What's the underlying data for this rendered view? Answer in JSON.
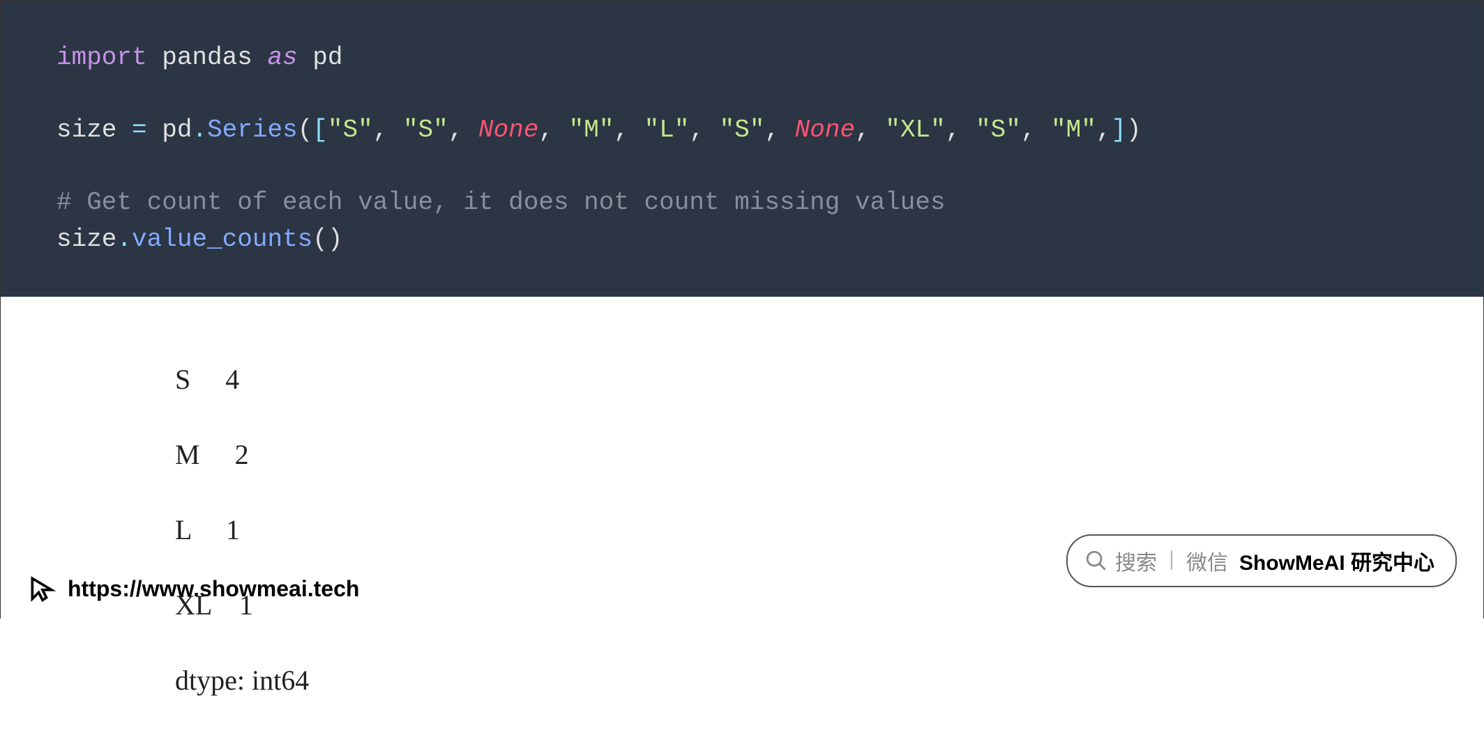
{
  "code": {
    "line1_import": "import",
    "line1_pandas": " pandas ",
    "line1_as": "as",
    "line1_pd": " pd",
    "line3_size": "size ",
    "line3_eq": "=",
    "line3_pd": " pd",
    "line3_dot": ".",
    "line3_series": "Series",
    "line3_po": "(",
    "line3_bo": "[",
    "line3_s1": "\"S\"",
    "line3_c": ", ",
    "line3_s2": "\"S\"",
    "line3_n1": "None",
    "line3_m1": "\"M\"",
    "line3_l1": "\"L\"",
    "line3_s3": "\"S\"",
    "line3_n2": "None",
    "line3_xl": "\"XL\"",
    "line3_s4": "\"S\"",
    "line3_m2": "\"M\"",
    "line3_trail": ",",
    "line3_bc": "]",
    "line3_pc": ")",
    "line5_comment": "# Get count of each value, it does not count missing values",
    "line6_size": "size",
    "line6_dot": ".",
    "line6_vc": "value_counts",
    "line6_po": "(",
    "line6_pc": ")"
  },
  "output": {
    "r1": "S     4",
    "r2": "M     2",
    "r3": "L     1",
    "r4": "XL    1",
    "r5": "dtype: int64"
  },
  "footer": {
    "url": "https://www.showmeai.tech"
  },
  "pill": {
    "search": "搜索",
    "wechat": "微信",
    "brand": "ShowMeAI 研究中心"
  }
}
